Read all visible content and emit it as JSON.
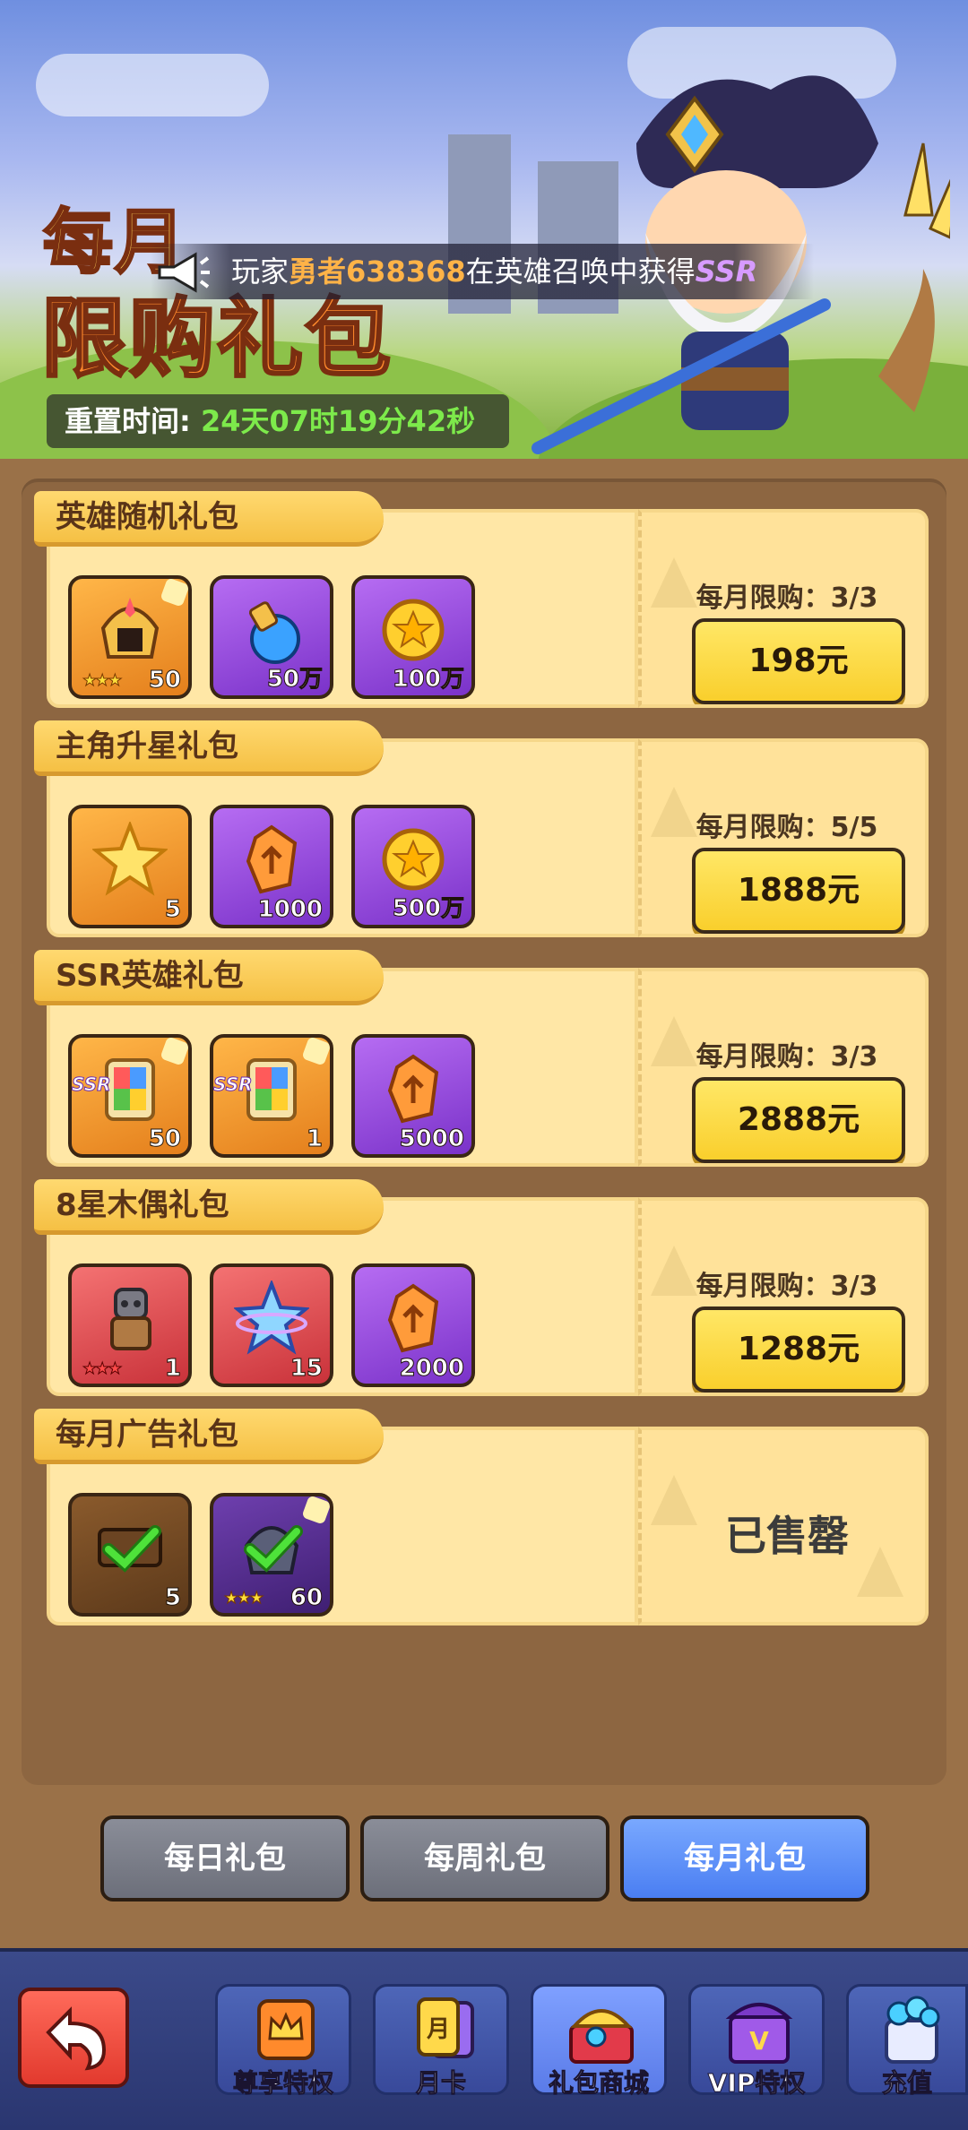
{
  "banner": {
    "title_line1": "每月",
    "title_line2": "限购礼包",
    "reset_label": "重置时间: ",
    "reset_time": "24天07时19分42秒",
    "ticker_prefix": "玩家",
    "ticker_player": "勇者638368",
    "ticker_middle": "在英雄召唤中获得",
    "ticker_reward": "SSR"
  },
  "packs": [
    {
      "title": "英雄随机礼包",
      "limit": "每月限购：3/3",
      "price": "198元",
      "items": [
        {
          "icon": "hero-helmet-icon",
          "qty": "50",
          "stars": "★★★"
        },
        {
          "icon": "blue-potion-icon",
          "qty": "50万"
        },
        {
          "icon": "gold-coin-icon",
          "qty": "100万"
        }
      ]
    },
    {
      "title": "主角升星礼包",
      "limit": "每月限购：5/5",
      "price": "1888元",
      "items": [
        {
          "icon": "gold-star-icon",
          "qty": "5"
        },
        {
          "icon": "upgrade-crystal-icon",
          "qty": "1000"
        },
        {
          "icon": "gold-coin-icon",
          "qty": "500万"
        }
      ]
    },
    {
      "title": "SSR英雄礼包",
      "limit": "每月限购：3/3",
      "price": "2888元",
      "items": [
        {
          "icon": "ssr-hero-card-icon",
          "qty": "50",
          "tag": "SSR"
        },
        {
          "icon": "ssr-hero-card-icon",
          "qty": "1",
          "tag": "SSR"
        },
        {
          "icon": "upgrade-crystal-icon",
          "qty": "5000"
        }
      ]
    },
    {
      "title": "8星木偶礼包",
      "limit": "每月限购：3/3",
      "price": "1288元",
      "items": [
        {
          "icon": "wooden-puppet-icon",
          "qty": "1",
          "stars": "★★★"
        },
        {
          "icon": "blue-star-gem-icon",
          "qty": "15"
        },
        {
          "icon": "upgrade-crystal-icon",
          "qty": "2000"
        }
      ]
    },
    {
      "title": "每月广告礼包",
      "status": "已售罄",
      "items": [
        {
          "icon": "ticket-check-icon",
          "qty": "5"
        },
        {
          "icon": "hero-check-icon",
          "qty": "60",
          "stars": "★★★"
        }
      ]
    }
  ],
  "tabs": [
    {
      "label": "每日礼包",
      "active": false
    },
    {
      "label": "每周礼包",
      "active": false
    },
    {
      "label": "每月礼包",
      "active": true
    }
  ],
  "nav": [
    {
      "label": "尊享特权",
      "icon": "crown-card-icon"
    },
    {
      "label": "月卡",
      "icon": "month-card-icon"
    },
    {
      "label": "礼包商城",
      "icon": "gift-chest-icon",
      "active": true
    },
    {
      "label": "VIP特权",
      "icon": "vip-chest-icon"
    },
    {
      "label": "充值",
      "icon": "gem-bag-icon"
    }
  ],
  "colors": {
    "accent_gold": "#f9cf2c",
    "tab_active": "#4a7ef2",
    "tab_inactive": "#6c6f7a",
    "timer_green": "#7dea4b",
    "panel_brown": "#8d6641"
  }
}
